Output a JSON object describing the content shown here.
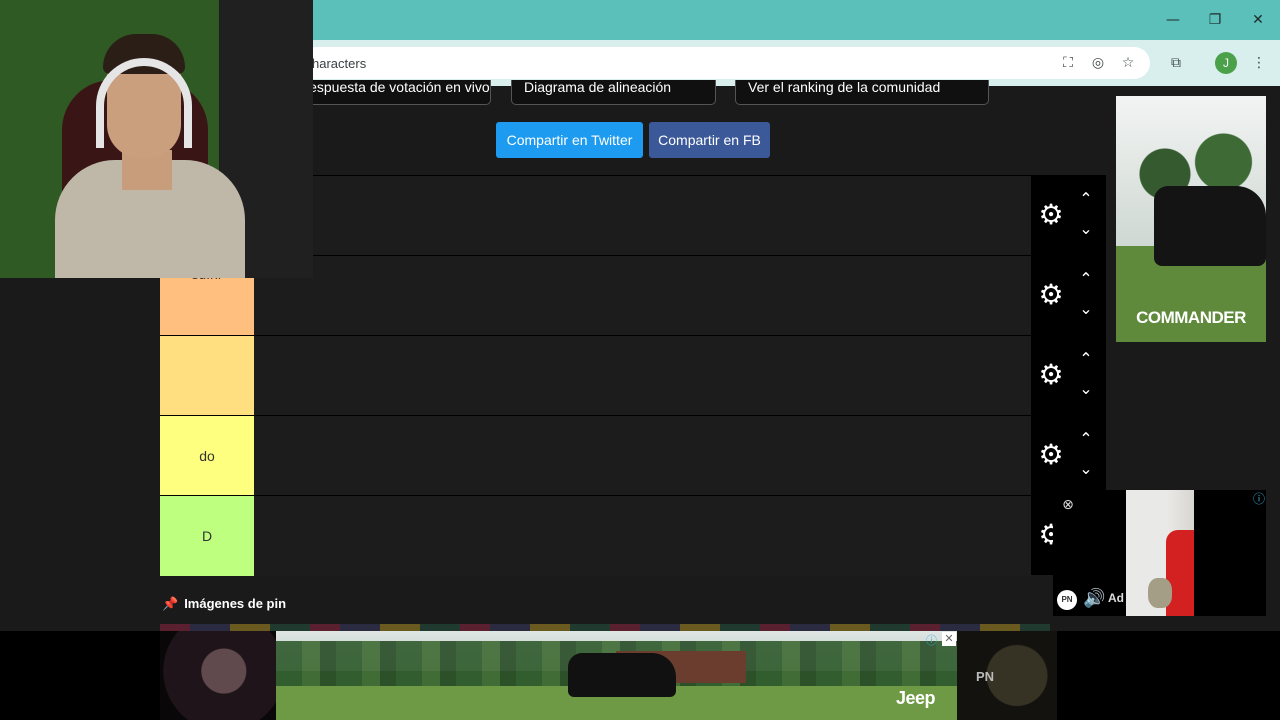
{
  "browser": {
    "url_partial": "haracters",
    "window_controls": [
      "—",
      "❐",
      "✕"
    ],
    "profile_initial": "J"
  },
  "page": {
    "top_buttons": [
      "Respuesta de votación en vivo",
      "Diagrama de alineación",
      "Ver el ranking de la comunidad"
    ],
    "share_twitter": "Compartir en Twitter",
    "share_fb": "Compartir en FB",
    "tiers": [
      {
        "label": "",
        "color": "#1c1c1c"
      },
      {
        "label": "sufrir",
        "color": "#ffbf7f"
      },
      {
        "label": "",
        "color": "#ffdf80"
      },
      {
        "label": "do",
        "color": "#ffff7f"
      },
      {
        "label": "D",
        "color": "#bfff7f"
      }
    ],
    "pin_label": "Imágenes de pin"
  },
  "ads": {
    "right_ad_text": "COMMANDER",
    "video_ad_badge": "Ad",
    "pn_badge": "PN",
    "bottom_brand": "Jeep",
    "bottom_pn": "PN"
  },
  "icons": {
    "gear": "⚙",
    "up": "⌃",
    "down": "⌄",
    "close": "⊗",
    "info": "ⓘ",
    "speaker": "🔊",
    "pin": "📌"
  }
}
